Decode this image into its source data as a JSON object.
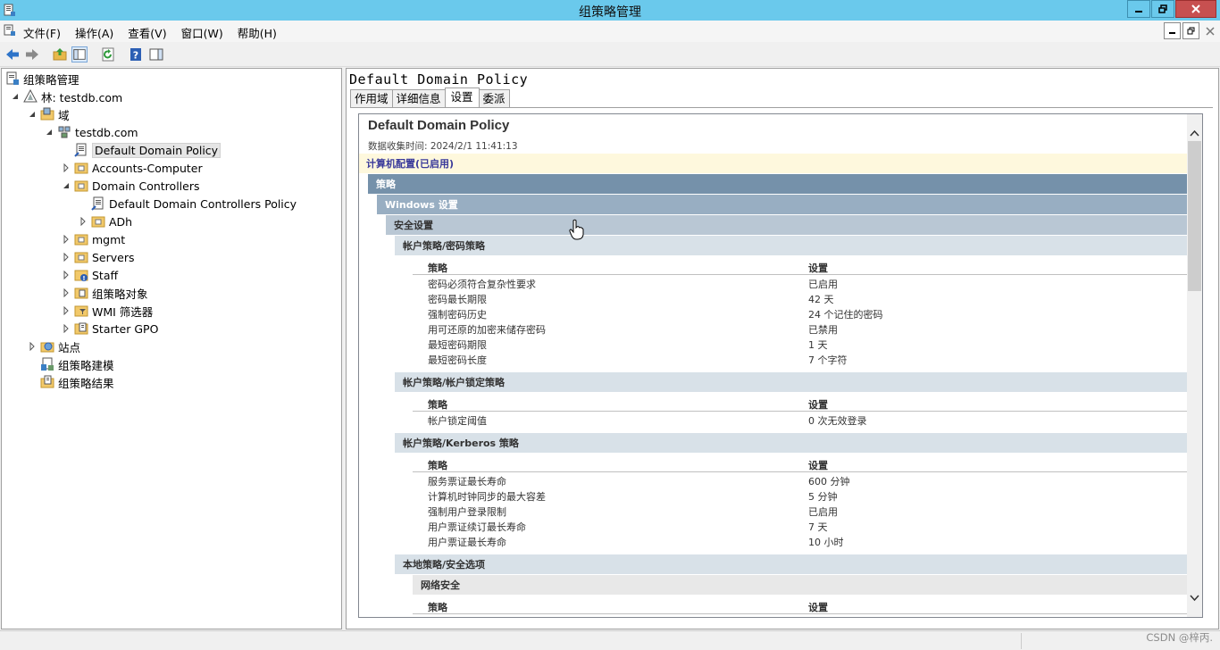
{
  "window": {
    "title": "组策略管理"
  },
  "menu": [
    "文件(F)",
    "操作(A)",
    "查看(V)",
    "窗口(W)",
    "帮助(H)"
  ],
  "toolbar": [
    "back-arrow-icon",
    "forward-arrow-icon",
    "up-folder-icon",
    "show-hide-tree-icon",
    "refresh-icon",
    "help-icon",
    "action-pane-icon"
  ],
  "tree": {
    "root": "组策略管理",
    "forest": "林: testdb.com",
    "domains": "域",
    "domain": "testdb.com",
    "items": [
      "Default Domain Policy",
      "Accounts-Computer",
      "Domain Controllers",
      "Default Domain Controllers Policy",
      "ADh",
      "mgmt",
      "Servers",
      "Staff",
      "组策略对象",
      "WMI 筛选器",
      "Starter GPO"
    ],
    "sites": "站点",
    "modeling": "组策略建模",
    "results": "组策略结果"
  },
  "gpo": {
    "title": "Default Domain Policy",
    "tabs": [
      "作用域",
      "详细信息",
      "设置",
      "委派"
    ],
    "active_tab": "设置"
  },
  "report": {
    "title": "Default Domain Policy",
    "collected": "数据收集时间: 2024/2/1 11:41:13",
    "computer_config": "计算机配置(已启用)",
    "policies": "策略",
    "windows_settings": "Windows 设置",
    "security_settings": "安全设置",
    "col_policy": "策略",
    "col_setting": "设置",
    "sections": [
      {
        "title": "帐户策略/密码策略",
        "rows": [
          [
            "密码必须符合复杂性要求",
            "已启用"
          ],
          [
            "密码最长期限",
            "42 天"
          ],
          [
            "强制密码历史",
            "24 个记住的密码"
          ],
          [
            "用可还原的加密来储存密码",
            "已禁用"
          ],
          [
            "最短密码期限",
            "1 天"
          ],
          [
            "最短密码长度",
            "7 个字符"
          ]
        ]
      },
      {
        "title": "帐户策略/帐户锁定策略",
        "rows": [
          [
            "帐户锁定阈值",
            "0 次无效登录"
          ]
        ]
      },
      {
        "title": "帐户策略/Kerberos 策略",
        "rows": [
          [
            "服务票证最长寿命",
            "600 分钟"
          ],
          [
            "计算机时钟同步的最大容差",
            "5 分钟"
          ],
          [
            "强制用户登录限制",
            "已启用"
          ],
          [
            "用户票证续订最长寿命",
            "7 天"
          ],
          [
            "用户票证最长寿命",
            "10 小时"
          ]
        ]
      },
      {
        "title": "本地策略/安全选项",
        "rows": []
      }
    ],
    "network_security": "网络安全"
  },
  "watermark": "CSDN @梓丙."
}
